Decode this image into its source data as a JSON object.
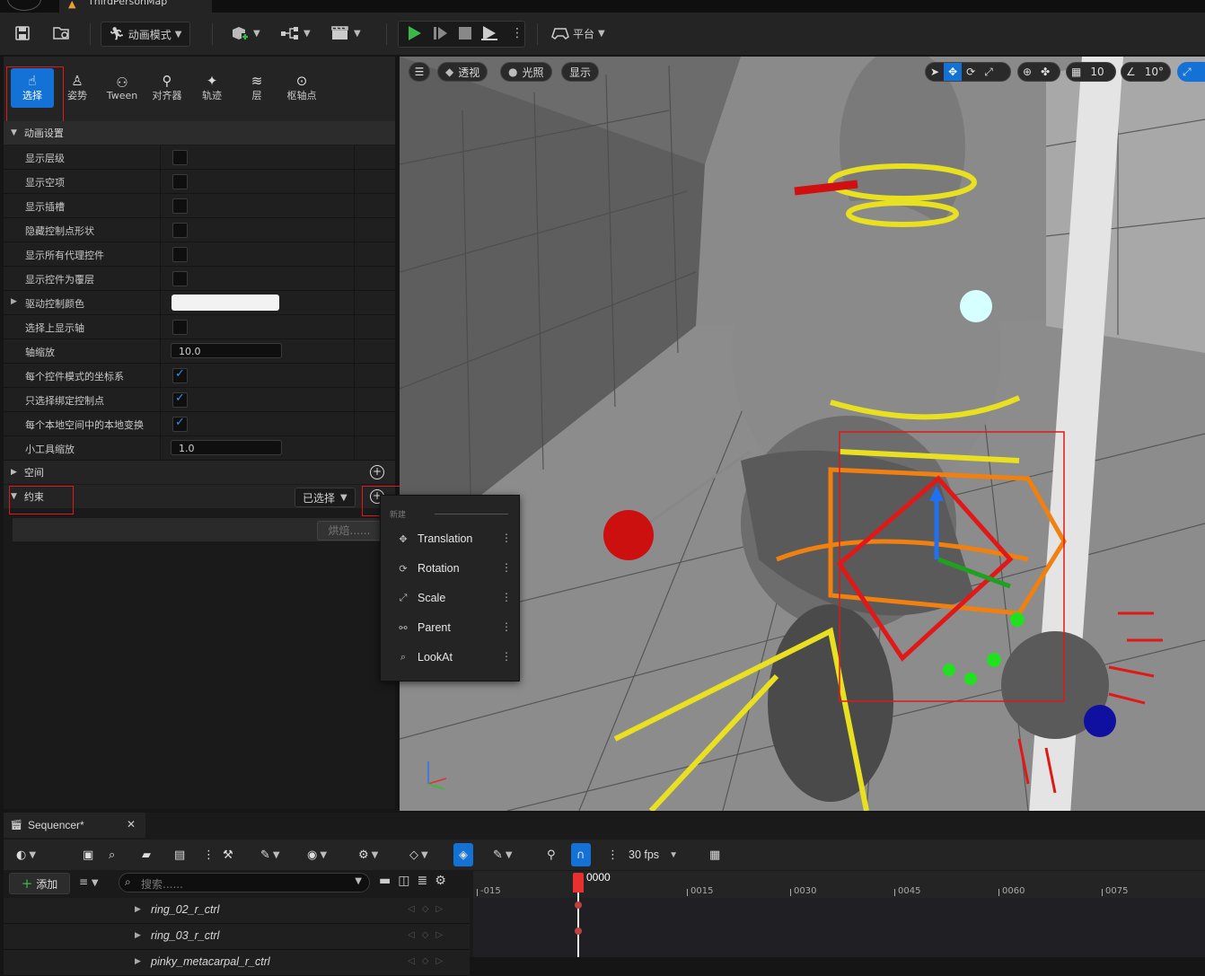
{
  "tabs": {
    "map_tab_label": "ThirdPersonMap"
  },
  "toolbar": {
    "mode_label": "动画模式",
    "platform_label": "平台"
  },
  "mode_tools": [
    {
      "label": "选择",
      "icon": "select-icon"
    },
    {
      "label": "姿势",
      "icon": "pose-icon"
    },
    {
      "label": "Tween",
      "icon": "tween-icon"
    },
    {
      "label": "对齐器",
      "icon": "snapper-icon"
    },
    {
      "label": "轨迹",
      "icon": "trails-icon"
    },
    {
      "label": "层",
      "icon": "layers-icon"
    },
    {
      "label": "枢轴点",
      "icon": "pivot-icon"
    }
  ],
  "anim_settings": {
    "header": "动画设置",
    "rows": [
      {
        "label": "显示层级",
        "type": "checkbox",
        "checked": false
      },
      {
        "label": "显示空项",
        "type": "checkbox",
        "checked": false
      },
      {
        "label": "显示插槽",
        "type": "checkbox",
        "checked": false
      },
      {
        "label": "隐藏控制点形状",
        "type": "checkbox",
        "checked": false
      },
      {
        "label": "显示所有代理控件",
        "type": "checkbox",
        "checked": false
      },
      {
        "label": "显示控件为覆层",
        "type": "checkbox",
        "checked": false
      },
      {
        "label": "驱动控制颜色",
        "type": "color",
        "value": "#f2f2f2"
      },
      {
        "label": "选择上显示轴",
        "type": "checkbox",
        "checked": false
      },
      {
        "label": "轴缩放",
        "type": "number",
        "value": "10.0"
      },
      {
        "label": "每个控件模式的坐标系",
        "type": "checkbox",
        "checked": true
      },
      {
        "label": "只选择绑定控制点",
        "type": "checkbox",
        "checked": true
      },
      {
        "label": "每个本地空间中的本地变换",
        "type": "checkbox",
        "checked": true
      },
      {
        "label": "小工具缩放",
        "type": "number",
        "value": "1.0"
      }
    ]
  },
  "space_section": {
    "label": "空间"
  },
  "constraint_section": {
    "label": "约束",
    "filter_label": "已选择",
    "bake_label": "烘焙......"
  },
  "popup_menu": {
    "header": "新建",
    "items": [
      {
        "label": "Translation",
        "icon": "translation-icon"
      },
      {
        "label": "Rotation",
        "icon": "rotation-icon"
      },
      {
        "label": "Scale",
        "icon": "scale-icon"
      },
      {
        "label": "Parent",
        "icon": "parent-icon"
      },
      {
        "label": "LookAt",
        "icon": "lookat-icon"
      }
    ]
  },
  "viewport": {
    "perspective_label": "透视",
    "lit_label": "光照",
    "show_label": "显示",
    "grid_snap_value": "10",
    "rotation_snap_value": "10°"
  },
  "sequencer": {
    "tab_label": "Sequencer*",
    "add_label": "添加",
    "search_placeholder": "搜索......",
    "fps_label": "30 fps",
    "current_frame": "0000",
    "ruler_ticks": [
      "-015",
      "0015",
      "0030",
      "0045",
      "0060",
      "0075"
    ],
    "tracks": [
      "ring_02_r_ctrl",
      "ring_03_r_ctrl",
      "pinky_metacarpal_r_ctrl"
    ]
  },
  "colors": {
    "accent_blue": "#1472d6",
    "highlight_red": "#e01818",
    "play_green": "#3cb84a",
    "playhead_red": "#e83030"
  }
}
